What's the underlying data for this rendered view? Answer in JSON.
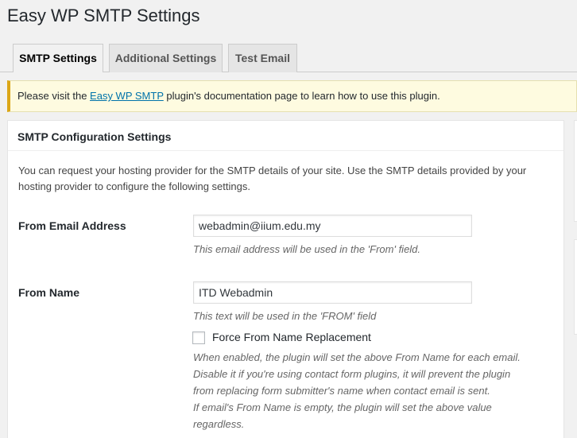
{
  "page": {
    "title": "Easy WP SMTP Settings"
  },
  "tabs": [
    {
      "label": "SMTP Settings",
      "active": true
    },
    {
      "label": "Additional Settings",
      "active": false
    },
    {
      "label": "Test Email",
      "active": false
    }
  ],
  "notice": {
    "prefix": "Please visit the ",
    "link_text": "Easy WP SMTP",
    "suffix": " plugin's documentation page to learn how to use this plugin."
  },
  "box": {
    "title": "SMTP Configuration Settings",
    "intro": "You can request your hosting provider for the SMTP details of your site. Use the SMTP details provided by your hosting provider to configure the following settings."
  },
  "fields": {
    "from_email": {
      "label": "From Email Address",
      "value": "webadmin@iium.edu.my",
      "description": "This email address will be used in the 'From' field."
    },
    "from_name": {
      "label": "From Name",
      "value": "ITD Webadmin",
      "description": "This text will be used in the 'FROM' field",
      "force_label": "Force From Name Replacement",
      "force_checked": false,
      "force_desc_lines": [
        "When enabled, the plugin will set the above From Name for each email.",
        "Disable it if you're using contact form plugins, it will prevent the plugin",
        "from replacing form submitter's name when contact email is sent.",
        "If email's From Name is empty, the plugin will set the above value",
        "regardless."
      ]
    }
  },
  "colors": {
    "link": "#0073aa",
    "notice_bg": "#fefbe0",
    "notice_border": "#dba617"
  }
}
